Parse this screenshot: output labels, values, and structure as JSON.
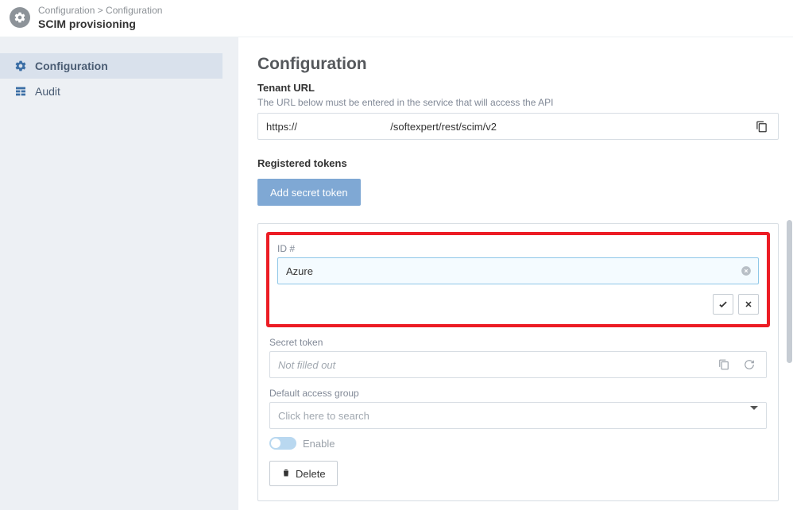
{
  "header": {
    "breadcrumb": "Configuration > Configuration",
    "title": "SCIM provisioning"
  },
  "sidebar": {
    "items": [
      {
        "label": "Configuration",
        "icon": "gear",
        "active": true
      },
      {
        "label": "Audit",
        "icon": "table",
        "active": false
      }
    ]
  },
  "main": {
    "title": "Configuration",
    "tenant": {
      "label": "Tenant URL",
      "help": "The URL below must be entered in the service that will access the API",
      "value_prefix": "https://",
      "value_suffix": "/softexpert/rest/scim/v2"
    },
    "tokens": {
      "label": "Registered tokens",
      "add_button": "Add secret token",
      "card": {
        "id_label": "ID #",
        "id_value": "Azure",
        "secret_label": "Secret token",
        "secret_placeholder": "Not filled out",
        "group_label": "Default access group",
        "group_placeholder": "Click here to search",
        "enable_label": "Enable",
        "delete_label": "Delete"
      }
    }
  }
}
